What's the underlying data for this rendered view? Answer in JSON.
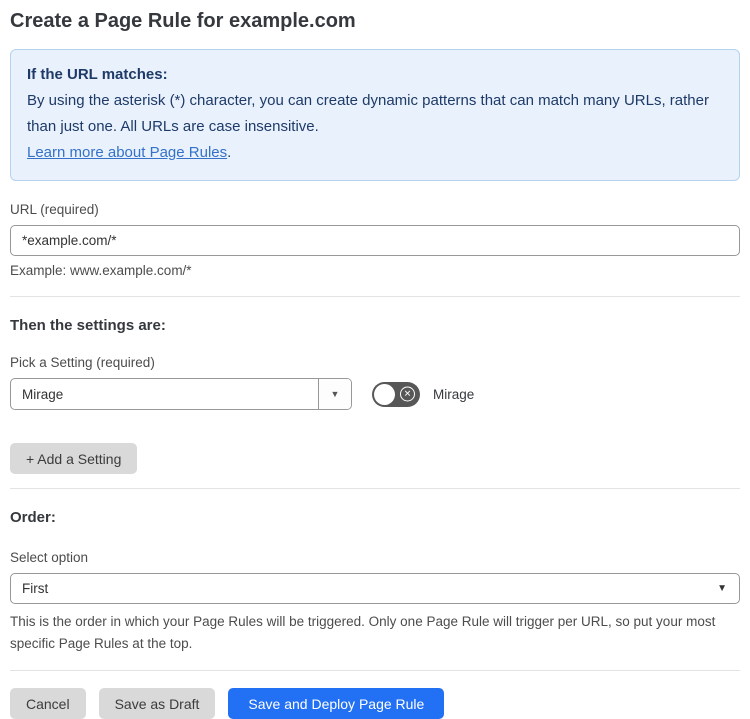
{
  "page": {
    "title": "Create a Page Rule for example.com"
  },
  "info_box": {
    "heading": "If the URL matches:",
    "body": "By using the asterisk (*) character, you can create dynamic patterns that can match many URLs, rather than just one. All URLs are case insensitive.",
    "link_label": "Learn more about Page Rules",
    "link_suffix": "."
  },
  "url_field": {
    "label": "URL (required)",
    "value": "*example.com/*",
    "hint": "Example: www.example.com/*"
  },
  "settings_section": {
    "heading": "Then the settings are:",
    "picker_label": "Pick a Setting (required)",
    "picker_value": "Mirage",
    "toggle_label": "Mirage",
    "toggle_state": "off",
    "add_button_label": "+ Add a Setting"
  },
  "order_section": {
    "heading": "Order:",
    "select_label": "Select option",
    "select_value": "First",
    "hint": "This is the order in which your Page Rules will be triggered. Only one Page Rule will trigger per URL, so put your most specific Page Rules at the top."
  },
  "footer": {
    "cancel_label": "Cancel",
    "save_draft_label": "Save as Draft",
    "save_deploy_label": "Save and Deploy Page Rule"
  },
  "icons": {
    "picker_dropdown_arrow": "▼",
    "select_dropdown_arrow": "▼",
    "toggle_x": "✕"
  },
  "colors": {
    "accent_blue": "#2270f3",
    "info_background": "#e9f2fc",
    "info_border": "#b5d2ef",
    "info_text": "#1e3a68",
    "link_blue": "#3471c8",
    "toggle_off_background": "#575757",
    "button_gray": "#d9d9d9"
  }
}
